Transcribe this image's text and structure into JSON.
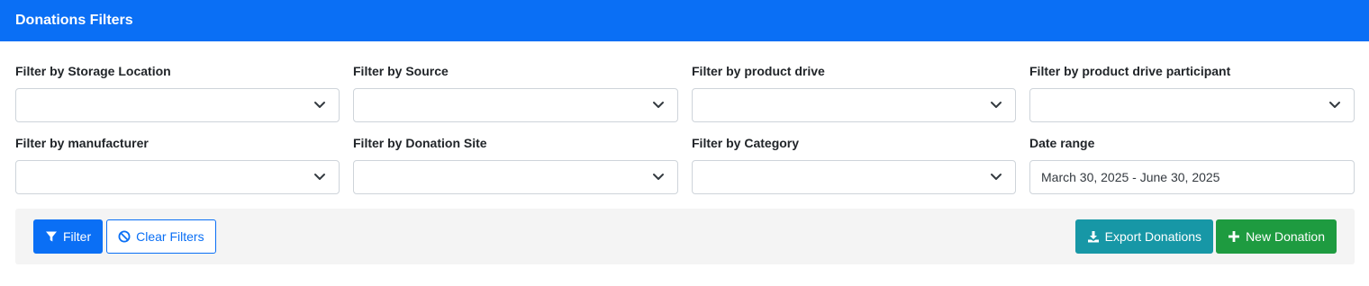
{
  "header": {
    "title": "Donations Filters"
  },
  "filters": {
    "storage_location": {
      "label": "Filter by Storage Location",
      "value": ""
    },
    "source": {
      "label": "Filter by Source",
      "value": ""
    },
    "product_drive": {
      "label": "Filter by product drive",
      "value": ""
    },
    "product_drive_participant": {
      "label": "Filter by product drive participant",
      "value": ""
    },
    "manufacturer": {
      "label": "Filter by manufacturer",
      "value": ""
    },
    "donation_site": {
      "label": "Filter by Donation Site",
      "value": ""
    },
    "category": {
      "label": "Filter by Category",
      "value": ""
    },
    "date_range": {
      "label": "Date range",
      "value": "March 30, 2025 - June 30, 2025"
    }
  },
  "toolbar": {
    "filter_label": "Filter",
    "clear_label": "Clear Filters",
    "export_label": "Export Donations",
    "new_label": "New Donation"
  },
  "icons": {
    "filter": "filter-icon",
    "clear": "ban-icon",
    "export": "download-icon",
    "new": "plus-icon",
    "dropdown": "chevron-down-icon"
  },
  "colors": {
    "primary": "#0a6ff5",
    "info": "#1797a6",
    "success": "#1e9b40",
    "toolbar_bg": "#f4f4f4"
  }
}
